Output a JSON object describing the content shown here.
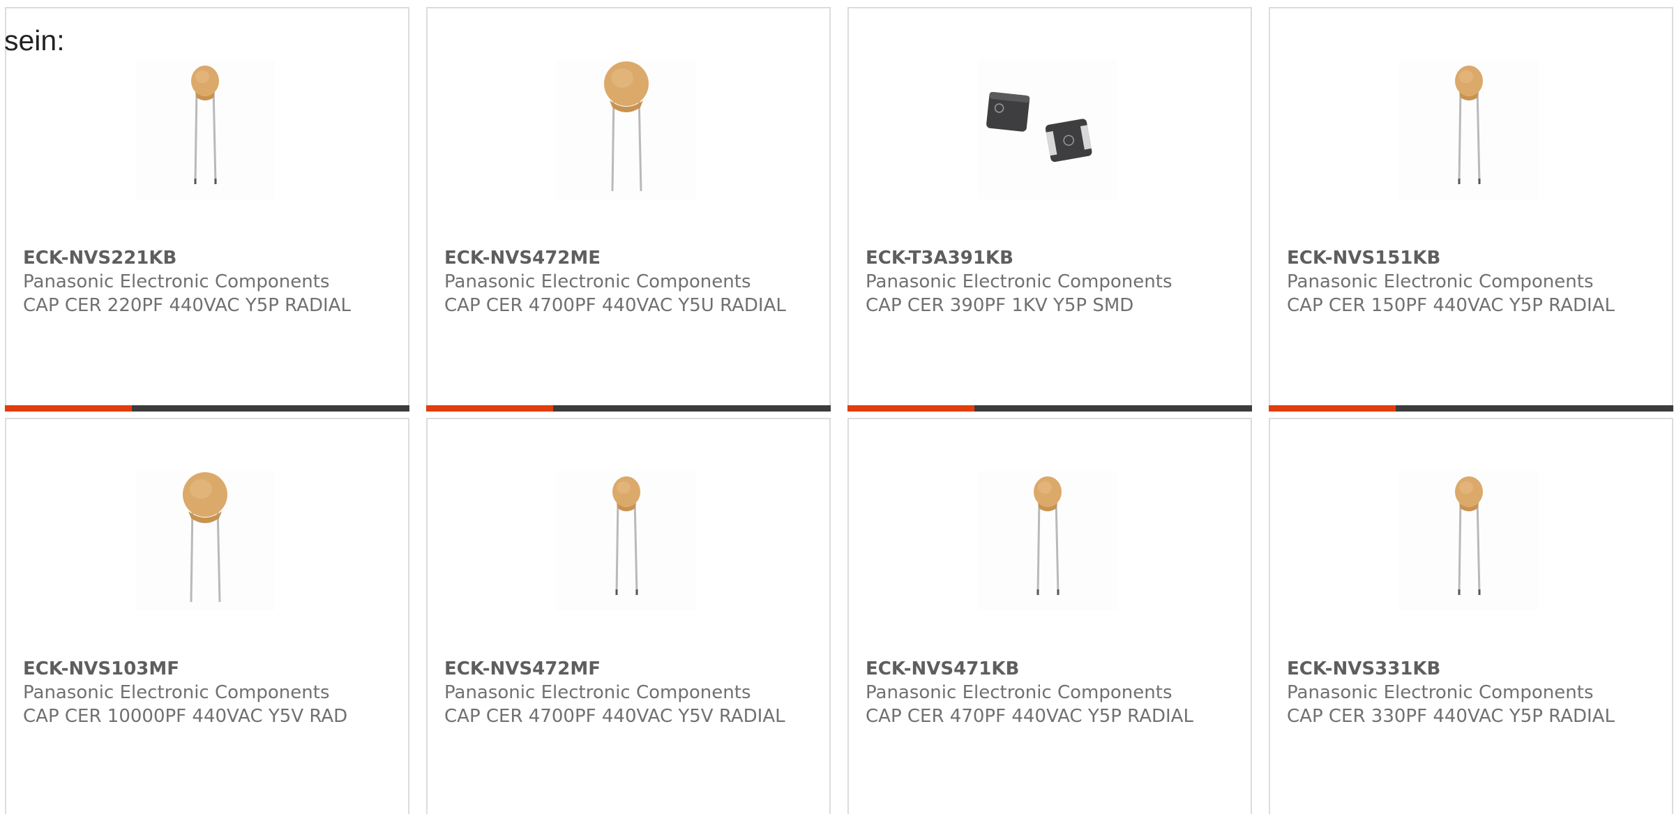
{
  "intro_text": "sein:",
  "colors": {
    "accent": "#e23d0c",
    "bar_dark": "#3c3c3c",
    "card_border": "#dcdcdc",
    "ceramic": "#dba96a"
  },
  "products": [
    {
      "part_number": "ECK-NVS221KB",
      "manufacturer": "Panasonic Electronic Components",
      "description": "CAP CER 220PF 440VAC Y5P RADIAL",
      "image": "small-disc-capacitor-icon"
    },
    {
      "part_number": "ECK-NVS472ME",
      "manufacturer": "Panasonic Electronic Components",
      "description": "CAP CER 4700PF 440VAC Y5U RADIAL",
      "image": "large-disc-capacitor-icon"
    },
    {
      "part_number": "ECK-T3A391KB",
      "manufacturer": "Panasonic Electronic Components",
      "description": "CAP CER 390PF 1KV Y5P SMD",
      "image": "smd-capacitor-icon"
    },
    {
      "part_number": "ECK-NVS151KB",
      "manufacturer": "Panasonic Electronic Components",
      "description": "CAP CER 150PF 440VAC Y5P RADIAL",
      "image": "small-disc-capacitor-icon"
    },
    {
      "part_number": "ECK-NVS103MF",
      "manufacturer": "Panasonic Electronic Components",
      "description": "CAP CER 10000PF 440VAC Y5V RAD",
      "image": "large-disc-capacitor-icon"
    },
    {
      "part_number": "ECK-NVS472MF",
      "manufacturer": "Panasonic Electronic Components",
      "description": "CAP CER 4700PF 440VAC Y5V RADIAL",
      "image": "small-disc-capacitor-icon"
    },
    {
      "part_number": "ECK-NVS471KB",
      "manufacturer": "Panasonic Electronic Components",
      "description": "CAP CER 470PF 440VAC Y5P RADIAL",
      "image": "small-disc-capacitor-icon"
    },
    {
      "part_number": "ECK-NVS331KB",
      "manufacturer": "Panasonic Electronic Components",
      "description": "CAP CER 330PF 440VAC Y5P RADIAL",
      "image": "small-disc-capacitor-icon"
    }
  ]
}
